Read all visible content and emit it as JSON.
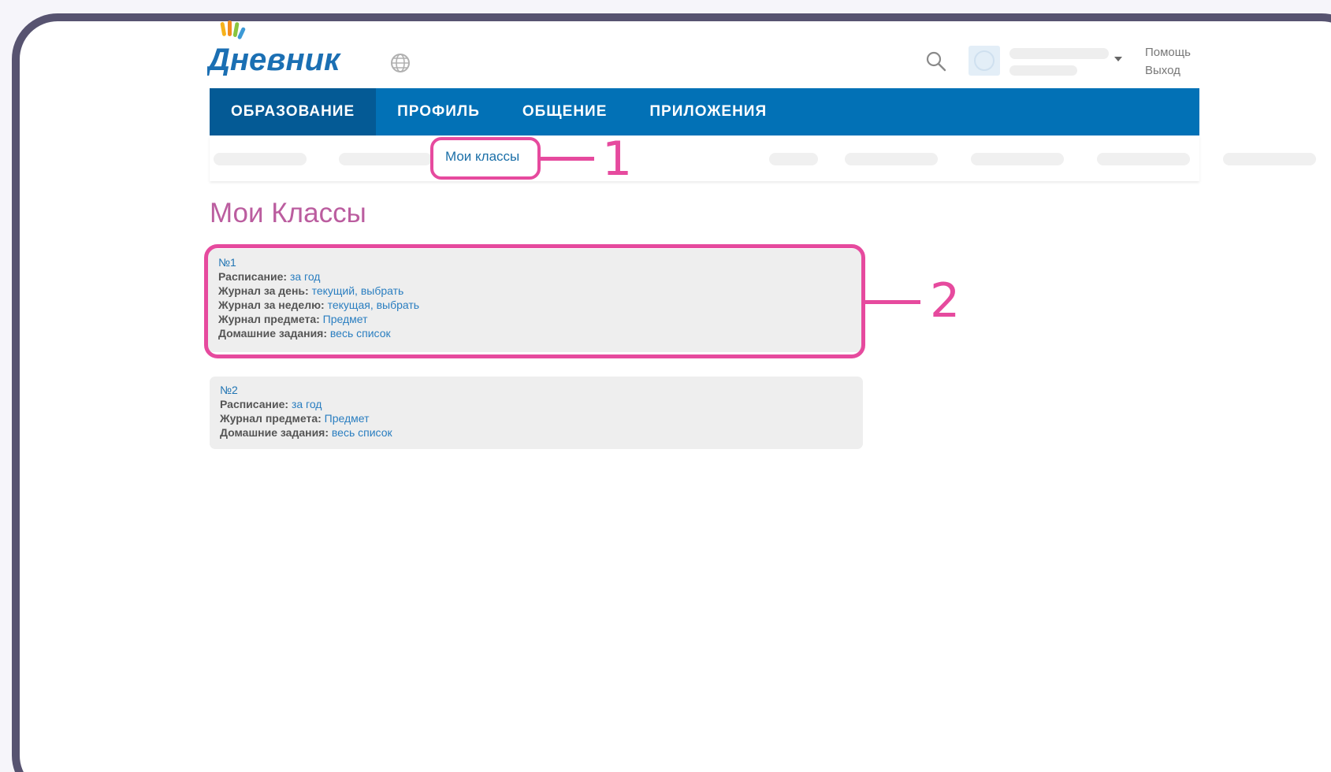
{
  "header": {
    "logo_text": "Дневник",
    "help_label": "Помощь",
    "logout_label": "Выход"
  },
  "nav": {
    "items": [
      {
        "label": "ОБРАЗОВАНИЕ",
        "active": true
      },
      {
        "label": "ПРОФИЛЬ",
        "active": false
      },
      {
        "label": "ОБЩЕНИЕ",
        "active": false
      },
      {
        "label": "ПРИЛОЖЕНИЯ",
        "active": false
      }
    ]
  },
  "subnav": {
    "active_label": "Мои классы"
  },
  "page": {
    "title": "Мои Классы"
  },
  "classes": [
    {
      "title": "№1",
      "rows": [
        {
          "label": "Расписание:",
          "links": "за год"
        },
        {
          "label": "Журнал за день:",
          "links": "текущий, выбрать"
        },
        {
          "label": "Журнал за неделю:",
          "links": "текущая, выбрать"
        },
        {
          "label": "Журнал предмета:",
          "links": "Предмет"
        },
        {
          "label": "Домашние задания:",
          "links": "весь список"
        }
      ]
    },
    {
      "title": "№2",
      "rows": [
        {
          "label": "Расписание:",
          "links": "за год"
        },
        {
          "label": "Журнал предмета:",
          "links": "Предмет"
        },
        {
          "label": "Домашние задания:",
          "links": "весь список"
        }
      ]
    }
  ],
  "annotations": {
    "callout_1": "1",
    "callout_2": "2",
    "color": "#e64a9e"
  },
  "colors": {
    "nav_bg": "#0271b6",
    "nav_active": "#045a95",
    "title": "#bb5d9f",
    "link": "#2a7ec0"
  },
  "icons": [
    "logo-hand-icon",
    "globe-icon",
    "search-icon",
    "avatar-icon",
    "caret-down-icon"
  ]
}
